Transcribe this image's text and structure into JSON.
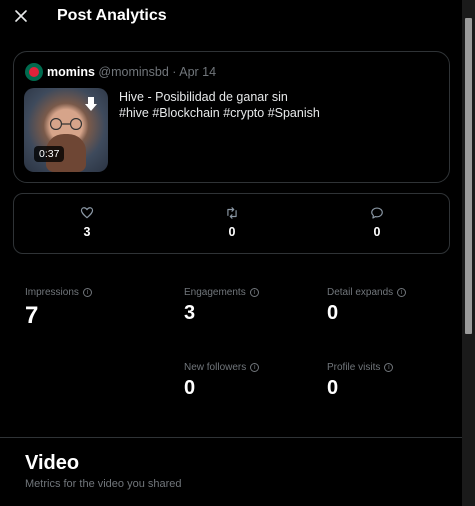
{
  "header": {
    "title": "Post Analytics"
  },
  "post": {
    "author_name": "momins",
    "author_handle": "@mominsbd",
    "separator": "·",
    "date": "Apr 14",
    "video_duration": "0:37",
    "text_line1": "Hive - Posibilidad de ganar sin",
    "text_line2": "#hive #Blockchain #crypto #Spanish"
  },
  "engagement_bar": {
    "likes": "3",
    "reposts": "0",
    "replies": "0"
  },
  "stats": {
    "impressions": {
      "label": "Impressions",
      "value": "7"
    },
    "engagements": {
      "label": "Engagements",
      "value": "3"
    },
    "detail_expands": {
      "label": "Detail expands",
      "value": "0"
    },
    "new_followers": {
      "label": "New followers",
      "value": "0"
    },
    "profile_visits": {
      "label": "Profile visits",
      "value": "0"
    }
  },
  "video_section": {
    "title": "Video",
    "subtitle": "Metrics for the video you shared"
  },
  "colors": {
    "background": "#000000",
    "border": "#2f3336",
    "muted": "#71767b",
    "text": "#e7e9ea"
  }
}
